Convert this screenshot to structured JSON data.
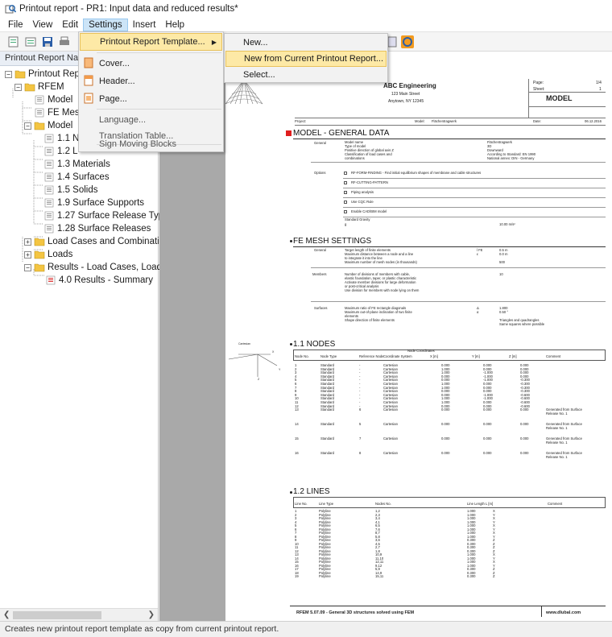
{
  "window": {
    "title": "Printout report - PR1: Input data and reduced results*"
  },
  "menubar": [
    "File",
    "View",
    "Edit",
    "Settings",
    "Insert",
    "Help"
  ],
  "nav": {
    "header": "Printout Report Nav",
    "items": [
      {
        "label": "Printout Rep",
        "kind": "folder-root"
      },
      {
        "label": "RFEM",
        "kind": "folder"
      },
      {
        "label": "Model",
        "kind": "doc"
      },
      {
        "label": "FE Mes",
        "kind": "doc"
      },
      {
        "label": "Model",
        "kind": "folder"
      },
      {
        "label": "1.1 N",
        "kind": "doc"
      },
      {
        "label": "1.2 L",
        "kind": "doc"
      },
      {
        "label": "1.3 Materials",
        "kind": "doc"
      },
      {
        "label": "1.4 Surfaces",
        "kind": "doc"
      },
      {
        "label": "1.5 Solids",
        "kind": "doc"
      },
      {
        "label": "1.9 Surface Supports",
        "kind": "doc"
      },
      {
        "label": "1.27 Surface Release Typ",
        "kind": "doc"
      },
      {
        "label": "1.28 Surface Releases",
        "kind": "doc"
      },
      {
        "label": "Load Cases and Combinatio",
        "kind": "folder"
      },
      {
        "label": "Loads",
        "kind": "folder"
      },
      {
        "label": "Results - Load Cases, Load C",
        "kind": "folder"
      },
      {
        "label": "4.0 Results - Summary",
        "kind": "doc-red"
      }
    ]
  },
  "settings_menu": {
    "items": [
      "Printout Report Template...",
      "Cover...",
      "Header...",
      "Page...",
      "Language...",
      "Translation Table...",
      "Sign Moving Blocks"
    ]
  },
  "template_submenu": {
    "items": [
      "New...",
      "New from Current Printout Report...",
      "Select..."
    ]
  },
  "status": "Creates new printout report template as copy from current printout report.",
  "page": {
    "company": "ABC Engineering",
    "street": "123 Main Street",
    "city": "Anytown, NY 12345",
    "page_label": "Page:",
    "page_val": "1/4",
    "sheet_label": "Sheet:",
    "sheet_val": "1",
    "model_box": "MODEL",
    "project_label": "Project:",
    "model_label": "Model:",
    "model_val": "Flächentragwerk",
    "date_label": "Date:",
    "date_val": "06.12.2016",
    "sec_model": "MODEL - GENERAL DATA",
    "gen_label": "General",
    "gen_lines": [
      "Model name",
      "Type of model",
      "Positive direction of global axis Z",
      "Classification of load cases and",
      "combinations"
    ],
    "gen_vals": [
      "Flächentragwerk",
      "3D",
      "Downward",
      "According to Standard: EN 1990",
      "National annex: DIN - Germany"
    ],
    "gen_colon": ":",
    "opt_label": "Options",
    "opt_lines": [
      "RF-FORM-FINDING - Find initial equilibrium shapes of membrane and cable structures",
      "RF-CUTTING-PATTERN",
      "Piping analysis",
      "Use CQC Rule",
      "Enable CAD/BIM model"
    ],
    "grav_label": "Standard Gravity",
    "grav_sym": "g",
    "grav_val": "10.00 m/s²",
    "sec_fe": "FE MESH SETTINGS",
    "fe_gen_lines": [
      "Target length of finite elements",
      "Maximum distance between a node and a line",
      "to integrate it into the line",
      "Maximum number of mesh nodes (in thousands)"
    ],
    "fe_gen_syms": [
      "l FE",
      "ε"
    ],
    "fe_gen_vals": [
      "0.5 m",
      "0.0 m",
      "500"
    ],
    "fe_mem_label": "Members",
    "fe_mem_lines": [
      "Number of divisions of members with cable,",
      "elastic foundation, taper, or plastic characteristic",
      "Activate member divisions for large deformation",
      "or post-critical analysis",
      "Use division for members with node lying on them"
    ],
    "fe_mem_val": "10",
    "fe_surf_label": "Surfaces",
    "fe_surf_lines": [
      "Maximum ratio of FE rectangle diagonals",
      "Maximum out-of-plane inclination of two finite",
      "elements",
      "Shape direction of finite elements"
    ],
    "fe_surf_syms": [
      "Δ",
      "α"
    ],
    "fe_surf_vals": [
      "1.800",
      "0.50 °",
      "Triangles and quadrangles",
      "Same squares where possible"
    ],
    "sec_nodes": "1.1 NODES",
    "nodes_hdr": [
      "Node No.",
      "Node Type",
      "Reference Node",
      "Coordinate System",
      "X [m]",
      "Y [m]",
      "Z [m]",
      "Comment"
    ],
    "nodes_coord_hdr": "Node Coordinates",
    "nodes": [
      [
        "1",
        "Standard",
        "-",
        "Cartesian",
        "0.000",
        "0.000",
        "0.000",
        ""
      ],
      [
        "2",
        "Standard",
        "-",
        "Cartesian",
        "1.000",
        "0.000",
        "0.000",
        ""
      ],
      [
        "3",
        "Standard",
        "-",
        "Cartesian",
        "1.000",
        "-1.000",
        "0.000",
        ""
      ],
      [
        "4",
        "Standard",
        "-",
        "Cartesian",
        "0.000",
        "-1.000",
        "0.000",
        ""
      ],
      [
        "5",
        "Standard",
        "-",
        "Cartesian",
        "0.000",
        "-1.000",
        "-0.300",
        ""
      ],
      [
        "6",
        "Standard",
        "-",
        "Cartesian",
        "1.000",
        "0.000",
        "-0.300",
        ""
      ],
      [
        "7",
        "Standard",
        "-",
        "Cartesian",
        "1.000",
        "0.000",
        "-0.300",
        ""
      ],
      [
        "8",
        "Standard",
        "-",
        "Cartesian",
        "0.000",
        "0.000",
        "-0.300",
        ""
      ],
      [
        "9",
        "Standard",
        "-",
        "Cartesian",
        "0.000",
        "-1.000",
        "-0.600",
        ""
      ],
      [
        "10",
        "Standard",
        "-",
        "Cartesian",
        "1.000",
        "-1.000",
        "-0.600",
        ""
      ],
      [
        "11",
        "Standard",
        "-",
        "Cartesian",
        "1.000",
        "0.000",
        "-0.600",
        ""
      ],
      [
        "12",
        "Standard",
        "-",
        "Cartesian",
        "0.000",
        "0.000",
        "-0.600",
        ""
      ],
      [
        "13",
        "Standard",
        "6",
        "Cartesian",
        "0.000",
        "0.000",
        "0.000",
        "Generated from Surface Release No. 1"
      ],
      [
        "14",
        "Standard",
        "5",
        "Cartesian",
        "0.000",
        "0.000",
        "0.000",
        "Generated from Surface Release No. 1"
      ],
      [
        "15",
        "Standard",
        "7",
        "Cartesian",
        "0.000",
        "0.000",
        "0.000",
        "Generated from Surface Release No. 1"
      ],
      [
        "16",
        "Standard",
        "8",
        "Cartesian",
        "0.000",
        "0.000",
        "0.000",
        "Generated from Surface Release No. 1"
      ]
    ],
    "sec_lines": "1.2 LINES",
    "lines_hdr": [
      "Line No.",
      "Line Type",
      "Nodes No.",
      "Line Length L [m]",
      "",
      "Comment"
    ],
    "lines": [
      [
        "1",
        "Polyline",
        "1,2",
        "1.000",
        "X"
      ],
      [
        "2",
        "Polyline",
        "2,3",
        "1.000",
        "Y"
      ],
      [
        "3",
        "Polyline",
        "3,4",
        "1.000",
        "X"
      ],
      [
        "4",
        "Polyline",
        "4,1",
        "1.000",
        "Y"
      ],
      [
        "5",
        "Polyline",
        "6,5",
        "1.000",
        "X"
      ],
      [
        "6",
        "Polyline",
        "7,6",
        "1.000",
        "Y"
      ],
      [
        "7",
        "Polyline",
        "8,7",
        "1.000",
        "X"
      ],
      [
        "8",
        "Polyline",
        "5,8",
        "1.000",
        "Y"
      ],
      [
        "9",
        "Polyline",
        "3,6",
        "0.300",
        "Z"
      ],
      [
        "10",
        "Polyline",
        "4,5",
        "0.300",
        "Z"
      ],
      [
        "11",
        "Polyline",
        "2,7",
        "0.300",
        "Z"
      ],
      [
        "12",
        "Polyline",
        "1,8",
        "0.300",
        "Z"
      ],
      [
        "13",
        "Polyline",
        "10,9",
        "1.000",
        "X"
      ],
      [
        "14",
        "Polyline",
        "11,10",
        "1.000",
        "Y"
      ],
      [
        "15",
        "Polyline",
        "12,11",
        "1.000",
        "X"
      ],
      [
        "16",
        "Polyline",
        "9,12",
        "1.000",
        "Y"
      ],
      [
        "17",
        "Polyline",
        "5,9",
        "0.300",
        "Z"
      ],
      [
        "18",
        "Polyline",
        "14,9",
        "0.300",
        "Z"
      ],
      [
        "19",
        "Polyline",
        "15,11",
        "0.300",
        "Z"
      ]
    ],
    "footer": "RFEM 5.07.09 - General 3D structures solved using FEM",
    "footer_url": "www.dlubal.com",
    "axes": [
      "Cartesian",
      "X",
      "Y",
      "Z"
    ]
  }
}
